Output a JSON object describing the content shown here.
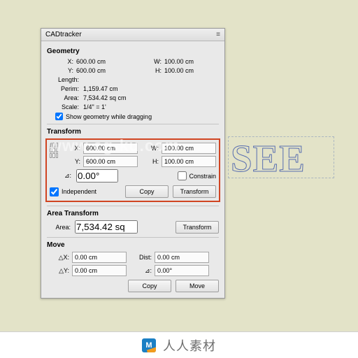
{
  "watermark": "www.cg-ku.com",
  "canvas_text": "SEE",
  "panel": {
    "title": "CADtracker",
    "geometry": {
      "heading": "Geometry",
      "x_label": "X:",
      "x_value": "600.00 cm",
      "w_label": "W:",
      "w_value": "100.00 cm",
      "y_label": "Y:",
      "y_value": "600.00 cm",
      "h_label": "H:",
      "h_value": "100.00 cm",
      "length_label": "Length:",
      "length_value": "",
      "perim_label": "Perim:",
      "perim_value": "1,159.47 cm",
      "area_label": "Area:",
      "area_value": "7,534.42 sq cm",
      "scale_label": "Scale:",
      "scale_value": "1/4\" = 1'",
      "show_while_drag": "Show geometry while dragging"
    },
    "transform": {
      "heading": "Transform",
      "x_label": "X:",
      "x_value": "600.00 cm",
      "w_label": "W:",
      "w_value": "100.00 cm",
      "y_label": "Y:",
      "y_value": "600.00 cm",
      "h_label": "H:",
      "h_value": "100.00 cm",
      "angle_label": "⊿:",
      "angle_value": "0.00°",
      "constrain_label": "Constrain",
      "independent_label": "Independent",
      "copy_btn": "Copy",
      "transform_btn": "Transform"
    },
    "area_transform": {
      "heading": "Area Transform",
      "area_label": "Area:",
      "area_value": "7,534.42 sq",
      "transform_btn": "Transform"
    },
    "move": {
      "heading": "Move",
      "dx_label": "△X:",
      "dx_value": "0.00 cm",
      "dist_label": "Dist:",
      "dist_value": "0.00 cm",
      "dy_label": "△Y:",
      "dy_value": "0.00 cm",
      "angle_label": "⊿:",
      "angle_value": "0.00°",
      "copy_btn": "Copy",
      "move_btn": "Move"
    }
  },
  "footer": {
    "brand_initial": "M",
    "brand_text": "人人素材"
  }
}
